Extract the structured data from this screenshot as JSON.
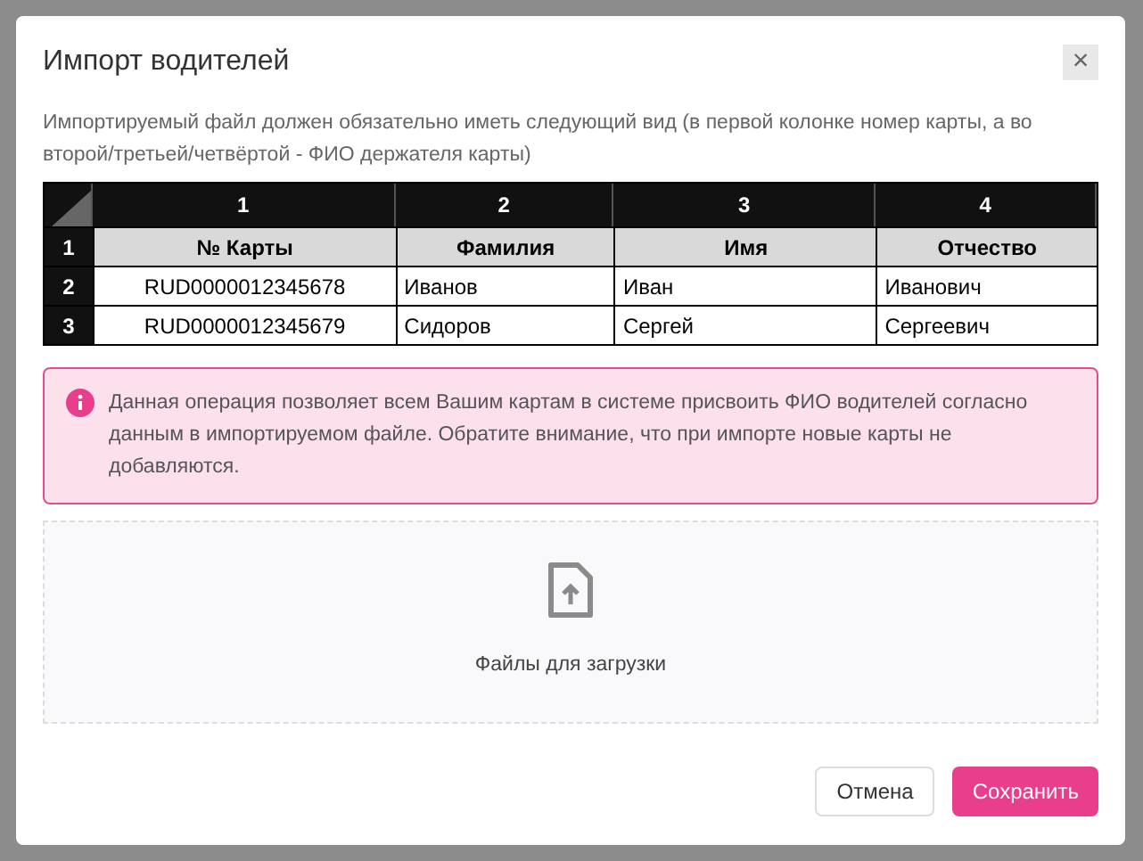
{
  "dialog": {
    "title": "Импорт водителей",
    "close_label": "×"
  },
  "description": "Импортируемый файл должен обязательно иметь следующий вид (в первой колонке номер карты, а во второй/третьей/четвёртой - ФИО держателя карты)",
  "sample_table": {
    "column_numbers": [
      "1",
      "2",
      "3",
      "4"
    ],
    "rows": [
      {
        "number": "1",
        "kind": "header",
        "cells": [
          "№ Карты",
          "Фамилия",
          "Имя",
          "Отчество"
        ]
      },
      {
        "number": "2",
        "kind": "data",
        "cells": [
          "RUD0000012345678",
          "Иванов",
          "Иван",
          "Иванович"
        ]
      },
      {
        "number": "3",
        "kind": "data",
        "cells": [
          "RUD0000012345679",
          "Сидоров",
          "Сергей",
          "Сергеевич"
        ]
      }
    ]
  },
  "alert": {
    "text": "Данная операция позволяет всем Вашим картам в системе присвоить ФИО водителей согласно данным в импортируемом файле. Обратите внимание, что при импорте новые карты не добавляются."
  },
  "dropzone": {
    "label": "Файлы для загрузки"
  },
  "buttons": [
    {
      "label": "Отмена",
      "kind": "secondary"
    },
    {
      "label": "Сохранить",
      "kind": "primary"
    }
  ]
}
